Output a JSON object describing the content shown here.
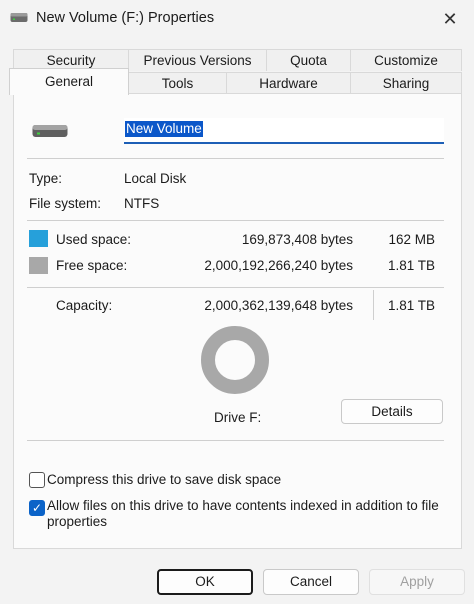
{
  "window": {
    "title": "New Volume (F:) Properties"
  },
  "tabs_back": [
    {
      "label": "Security"
    },
    {
      "label": "Previous Versions"
    },
    {
      "label": "Quota"
    },
    {
      "label": "Customize"
    }
  ],
  "tabs_front": [
    {
      "label": "General"
    },
    {
      "label": "Tools"
    },
    {
      "label": "Hardware"
    },
    {
      "label": "Sharing"
    }
  ],
  "general": {
    "volume_name": "New Volume",
    "type_label": "Type:",
    "type_value": "Local Disk",
    "fs_label": "File system:",
    "fs_value": "NTFS",
    "used": {
      "label": "Used space:",
      "bytes": "169,873,408 bytes",
      "size": "162 MB",
      "color": "#26a0da"
    },
    "free": {
      "label": "Free space:",
      "bytes": "2,000,192,266,240 bytes",
      "size": "1.81 TB",
      "color": "#a8a8a8"
    },
    "capacity": {
      "label": "Capacity:",
      "bytes": "2,000,362,139,648 bytes",
      "size": "1.81 TB"
    },
    "used_fraction": 8.5e-05,
    "drive_label": "Drive F:",
    "details_button": "Details",
    "compress_label": "Compress this drive to save disk space",
    "compress_checked": false,
    "index_label_line1": "Allow files on this drive to have contents indexed in addition to file",
    "index_label_line2": "properties",
    "index_checked": true
  },
  "buttons": {
    "ok": "OK",
    "cancel": "Cancel",
    "apply": "Apply"
  }
}
